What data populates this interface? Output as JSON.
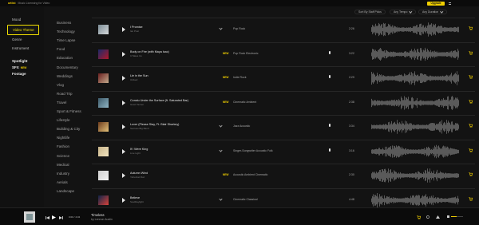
{
  "app": {
    "logo": "artlist",
    "tagline": "Music Licensing for Video",
    "upgrade_label": "Upgrade"
  },
  "sidebar": {
    "items": [
      {
        "label": "Mood"
      },
      {
        "label": "Video Theme",
        "active": true
      },
      {
        "label": "Genre"
      },
      {
        "label": "Instrument"
      }
    ],
    "extras": [
      {
        "label": "Spotlight"
      },
      {
        "label": "SFX",
        "badge": "NEW"
      },
      {
        "label": "Footage"
      }
    ]
  },
  "categories": [
    "Business",
    "Technology",
    "Time Lapse",
    "Food",
    "Education",
    "Documentary",
    "Weddings",
    "Vlog",
    "Road Trip",
    "Travel",
    "Sport & Fitness",
    "Lifestyle",
    "Building & City",
    "Nightlife",
    "Fashion",
    "Science",
    "Medical",
    "Industry",
    "Aerials",
    "Landscape"
  ],
  "filters": {
    "sort": "Sort By Staff Picks",
    "tempo": "Any Tempo",
    "duration": "Any Duration"
  },
  "tracks": [
    {
      "title": "I Promise",
      "artist": "Ian Post",
      "badge": "",
      "tags": "Pop  Rock",
      "duration": "2:26",
      "vocal": false,
      "thumb_color": "#7b8d96",
      "thumb_color2": "#d5d8da"
    },
    {
      "title": "Body on Fire (with Maya Isac)",
      "artist": "It Takes Us",
      "badge": "NEW",
      "tags": "Pop  Rock  Electronic",
      "duration": "3:22",
      "vocal": true,
      "thumb_color": "#1b2a6a",
      "thumb_color2": "#b0182a"
    },
    {
      "title": "Lie in the Sun",
      "artist": "Uldved",
      "badge": "NEW",
      "tags": "Indie  Rock",
      "duration": "2:29",
      "vocal": true,
      "thumb_color": "#6a1f1f",
      "thumb_color2": "#c2a98a"
    },
    {
      "title": "Constu Under the Surface (ft. Saturated Bar)",
      "artist": "Goaz Tanner",
      "badge": "NEW",
      "tags": "Cinematic  Ambient",
      "duration": "2:38",
      "vocal": false,
      "thumb_color": "#3d5a6a",
      "thumb_color2": "#8fb4c3"
    },
    {
      "title": "Lover (Please Stay, Ft. Blair Sharkey)",
      "artist": "Secluso Big Band",
      "badge": "",
      "tags": "Jazz  Acoustic",
      "duration": "3:34",
      "vocal": true,
      "thumb_color": "#6b3b1c",
      "thumb_color2": "#e4c27a"
    },
    {
      "title": "If I Were King",
      "artist": "Live Light",
      "badge": "",
      "tags": "Singer-Songwriter  Acoustic  Folk",
      "duration": "3:16",
      "vocal": true,
      "thumb_color": "#c8b48a",
      "thumb_color2": "#f1e4bf"
    },
    {
      "title": "Autumn Wind",
      "artist": "Yehezkel Raz",
      "badge": "NEW",
      "tags": "Acoustic  Ambient  Cinematic",
      "duration": "2:30",
      "vocal": false,
      "thumb_color": "#cfcfcf",
      "thumb_color2": "#f2f2f2"
    },
    {
      "title": "Believe",
      "artist": "SoulDaylight",
      "badge": "",
      "tags": "Cinematic  Classical",
      "duration": "4:48",
      "vocal": false,
      "thumb_color": "#0e2448",
      "thumb_color2": "#d8423a"
    }
  ],
  "player": {
    "time": "0:00 / 4:34",
    "title": "Timeless",
    "artist": "by Lennon Austin",
    "volume": 0.45
  },
  "colors": {
    "accent": "#f1cf00",
    "background": "#131313"
  }
}
